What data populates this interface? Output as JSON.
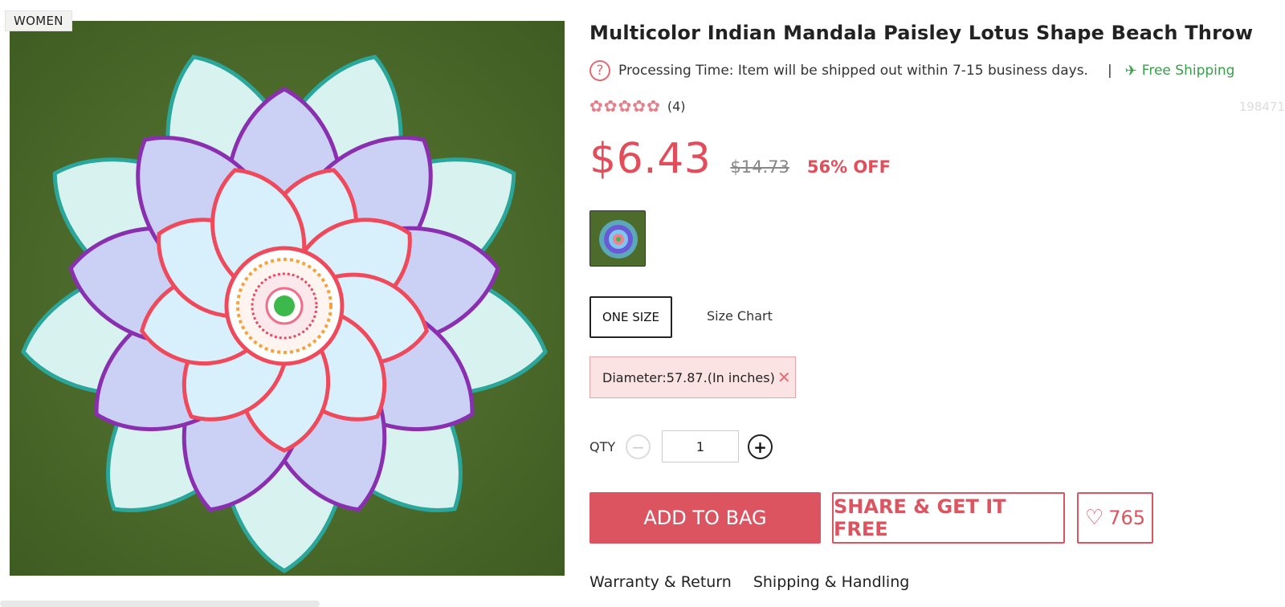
{
  "category_badge": "WOMEN",
  "product": {
    "title": "Multicolor Indian Mandala Paisley Lotus Shape Beach Throw",
    "processing_time": "Processing Time: Item will be shipped out within 7-15 business days.",
    "separator": "|",
    "shipping": "Free Shipping",
    "rating_count": "(4)",
    "sku": "198471",
    "price": "$6.43",
    "original_price": "$14.73",
    "discount": "56% OFF"
  },
  "size": {
    "selected": "ONE SIZE",
    "size_chart_label": "Size Chart",
    "note": "Diameter:57.87.(In inches)"
  },
  "quantity": {
    "label": "QTY",
    "value": "1",
    "minus": "−",
    "plus": "+"
  },
  "actions": {
    "add_to_bag": "ADD TO BAG",
    "share": "SHARE & GET IT FREE",
    "wishlist_count": "765"
  },
  "tabs": [
    "Warranty & Return",
    "Shipping & Handling"
  ],
  "icons": {
    "help": "question-icon",
    "plane": "plane-icon",
    "rating": "rose-icon",
    "heart": "heart-icon",
    "close": "close-icon"
  },
  "colors": {
    "accent": "#dc5460",
    "price": "#e34d5a",
    "shipping": "#3a9e4a"
  }
}
